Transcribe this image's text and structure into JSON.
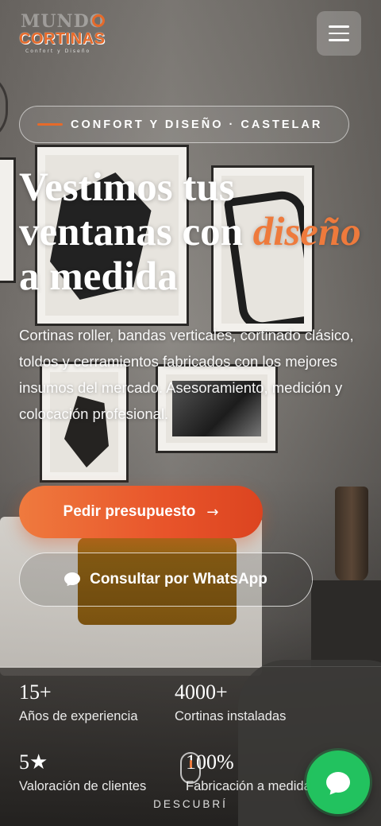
{
  "brand": {
    "logo_top": "MUNDO",
    "logo_main": "CORTINAS",
    "logo_tagline": "Confort y Diseño"
  },
  "header": {
    "menu_icon": "hamburger-menu-icon"
  },
  "hero": {
    "eyebrow": "CONFORT Y DISEÑO · CASTELAR",
    "headline_part1": "Vestimos tus ventanas con ",
    "headline_accent": "diseño",
    "headline_part2": " a medida",
    "lead": "Cortinas roller, bandas verticales, cortinado clásico, toldos y cerramientos fabricados con los mejores insumos del mercado. Asesoramiento, medición y colocación profesional.",
    "accent_color": "#ee7a3c"
  },
  "cta": {
    "primary_label": "Pedir presupuesto",
    "primary_icon": "arrow-right-icon",
    "secondary_label": "Consultar por WhatsApp",
    "secondary_icon": "chat-bubble-icon"
  },
  "stats": [
    {
      "value": "15+",
      "label": "Años de experiencia"
    },
    {
      "value": "4000+",
      "label": "Cortinas instaladas"
    },
    {
      "value": "5★",
      "label": "Valoración de clientes"
    },
    {
      "value": "100%",
      "label": "Fabricación a medida"
    }
  ],
  "scroll_hint": {
    "label": "DESCUBRÍ",
    "icon": "mouse-scroll-icon"
  },
  "floating": {
    "whatsapp_icon": "whatsapp-icon",
    "color": "#22c25f"
  }
}
